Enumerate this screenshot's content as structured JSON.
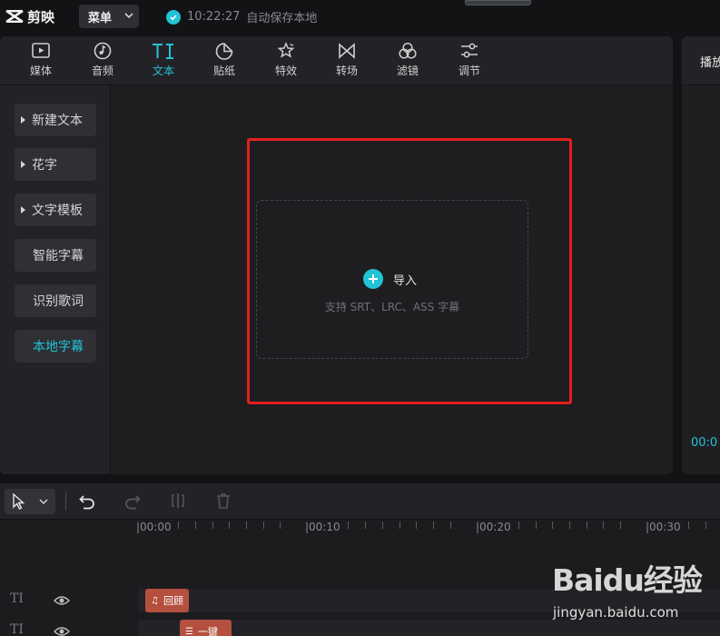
{
  "app": {
    "name": "剪映",
    "menu_label": "菜单",
    "save_time": "10:22:27",
    "save_text": "自动保存本地"
  },
  "tabs": [
    {
      "label": "媒体",
      "icon": "media-icon"
    },
    {
      "label": "音频",
      "icon": "audio-icon"
    },
    {
      "label": "文本",
      "icon": "text-icon",
      "active": true
    },
    {
      "label": "贴纸",
      "icon": "sticker-icon"
    },
    {
      "label": "特效",
      "icon": "effects-icon"
    },
    {
      "label": "转场",
      "icon": "transition-icon"
    },
    {
      "label": "滤镜",
      "icon": "filter-icon"
    },
    {
      "label": "调节",
      "icon": "adjust-icon"
    }
  ],
  "sidebar": {
    "items": [
      {
        "label": "新建文本",
        "expandable": true
      },
      {
        "label": "花字",
        "expandable": true
      },
      {
        "label": "文字模板",
        "expandable": true
      },
      {
        "label": "智能字幕",
        "expandable": false
      },
      {
        "label": "识别歌词",
        "expandable": false
      },
      {
        "label": "本地字幕",
        "expandable": false,
        "active": true
      }
    ]
  },
  "import": {
    "label": "导入",
    "hint": "支持 SRT、LRC、ASS 字幕"
  },
  "player": {
    "title": "播放",
    "time": "00:0"
  },
  "timeline": {
    "ruler": [
      "|00:00",
      "|00:10",
      "|00:20",
      "|00:30"
    ],
    "tracks": [
      {
        "type_icon": "TI",
        "clip_label": "回顾",
        "clip_icon": "♫"
      },
      {
        "type_icon": "TI",
        "clip_label": "一键",
        "clip_icon": "☰"
      }
    ]
  },
  "watermark": {
    "brand": "Baidu经验",
    "url": "jingyan.baidu.com"
  },
  "colors": {
    "accent": "#22c3d6",
    "highlight": "#e4201c",
    "clip": "#b5503f"
  }
}
